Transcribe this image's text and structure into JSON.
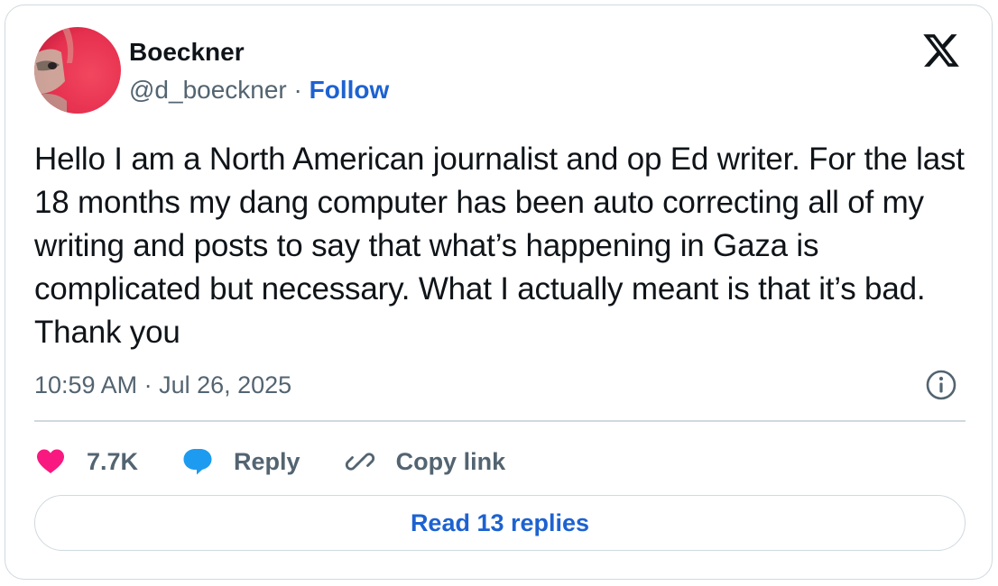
{
  "author": {
    "name": "Boeckner",
    "handle": "@d_boeckner",
    "separator": "·",
    "follow_label": "Follow",
    "avatar_icon": "avatar-photo"
  },
  "platform": {
    "logo_icon": "x-logo-icon"
  },
  "tweet": {
    "text": "Hello I am a North American journalist and op Ed writer. For the last 18 months my dang computer has been auto correcting all of my writing and posts to say that what’s happening in Gaza is complicated but necessary. What I actually meant is that it’s bad. Thank you",
    "timestamp": "10:59 AM · Jul 26, 2025"
  },
  "actions": {
    "like_count": "7.7K",
    "reply_label": "Reply",
    "copy_link_label": "Copy link"
  },
  "replies": {
    "read_label": "Read 13 replies"
  },
  "colors": {
    "accent": "#1d62d1",
    "like": "#f91880",
    "reply_bubble": "#1d9bf0",
    "muted_text": "#536471",
    "border": "#cfd9de"
  }
}
